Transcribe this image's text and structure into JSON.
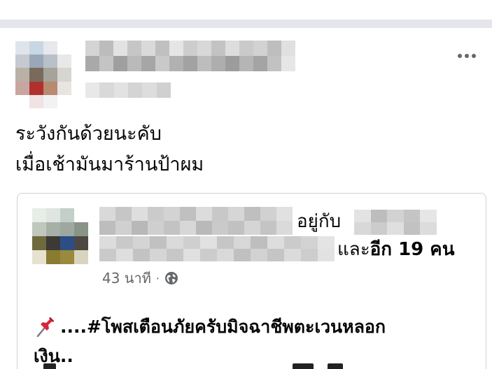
{
  "post": {
    "line1": "ระวังกันด้วยนะคับ",
    "line2": "เมื่อเช้ามันมาร้านป้าผม"
  },
  "shared": {
    "with_label": "อยู่กับ",
    "and_label": "และ",
    "others_label": "อีก 19 คน",
    "time": "43 นาที",
    "meta_separator": "·",
    "hashtag_line": "....#โพสเตือนภัยครับมิจฉาชีพตะเวนหลอก",
    "hashtag_line2": "เงิน..",
    "pin_icon": "pushpin-icon",
    "globe_icon": "globe-icon"
  },
  "colors": {
    "separator": "#e4e6eb",
    "meta_text": "#65676b",
    "card_border": "#ced0d4"
  }
}
